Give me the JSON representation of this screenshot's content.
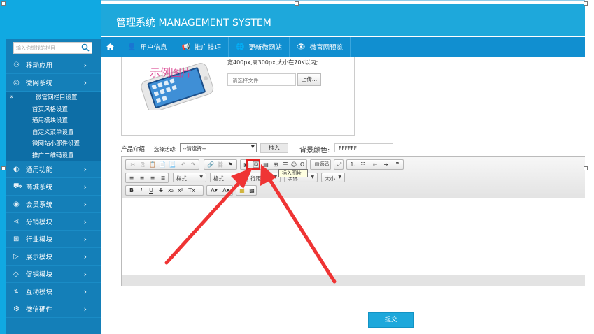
{
  "header": {
    "title": "管理系统 MANAGEMENT SYSTEM"
  },
  "nav": {
    "home_icon": "home-icon",
    "items": [
      {
        "label": "用户信息",
        "icon": "user-icon"
      },
      {
        "label": "推广技巧",
        "icon": "megaphone-icon"
      },
      {
        "label": "更新微网站",
        "icon": "globe-icon"
      },
      {
        "label": "微官网预览",
        "icon": "eye-icon"
      }
    ]
  },
  "sidebar": {
    "search_placeholder": "输入你想找的栏目",
    "items": [
      {
        "label": "移动应用",
        "icon": "apps-icon"
      },
      {
        "label": "微网系统",
        "icon": "globe-icon"
      },
      {
        "label": "通用功能",
        "icon": "function-icon"
      },
      {
        "label": "商城系统",
        "icon": "cart-icon"
      },
      {
        "label": "会员系统",
        "icon": "vip-icon"
      },
      {
        "label": "分销模块",
        "icon": "share-icon"
      },
      {
        "label": "行业模块",
        "icon": "grid-icon"
      },
      {
        "label": "展示模块",
        "icon": "display-icon"
      },
      {
        "label": "促销模块",
        "icon": "tag-icon"
      },
      {
        "label": "互动模块",
        "icon": "interact-icon"
      },
      {
        "label": "微信硬件",
        "icon": "hardware-icon"
      }
    ],
    "sub_items": [
      {
        "label": "微官网栏目设置",
        "active": true
      },
      {
        "label": "首页风格设置"
      },
      {
        "label": "通用模块设置"
      },
      {
        "label": "自定义菜单设置"
      },
      {
        "label": "微网站小部件设置"
      },
      {
        "label": "推广二维码设置"
      }
    ]
  },
  "image_section": {
    "watermark": "示例图片",
    "size_note": "宽400px,高300px,大小在70K以内;",
    "file_placeholder": "请选择文件...",
    "upload_label": "上传..."
  },
  "intro": {
    "label": "产品介绍:",
    "select_activity_label": "选择活动:",
    "select_value": "--请选择--",
    "insert_label": "插入",
    "bg_color_label": "背景颜色:",
    "bg_color_value": "FFFFFF"
  },
  "editor": {
    "source_label": "源码",
    "style_combo": "样式",
    "format_combo": "格式",
    "line_combo": "行距",
    "font_combo": "字体",
    "size_combo": "大小",
    "tooltip": "插入图片"
  },
  "submit_label": "提交",
  "colors": {
    "accent": "#1ea8db",
    "nav": "#118fd0",
    "sidebar": "#147fb8",
    "highlight": "#e52222"
  }
}
